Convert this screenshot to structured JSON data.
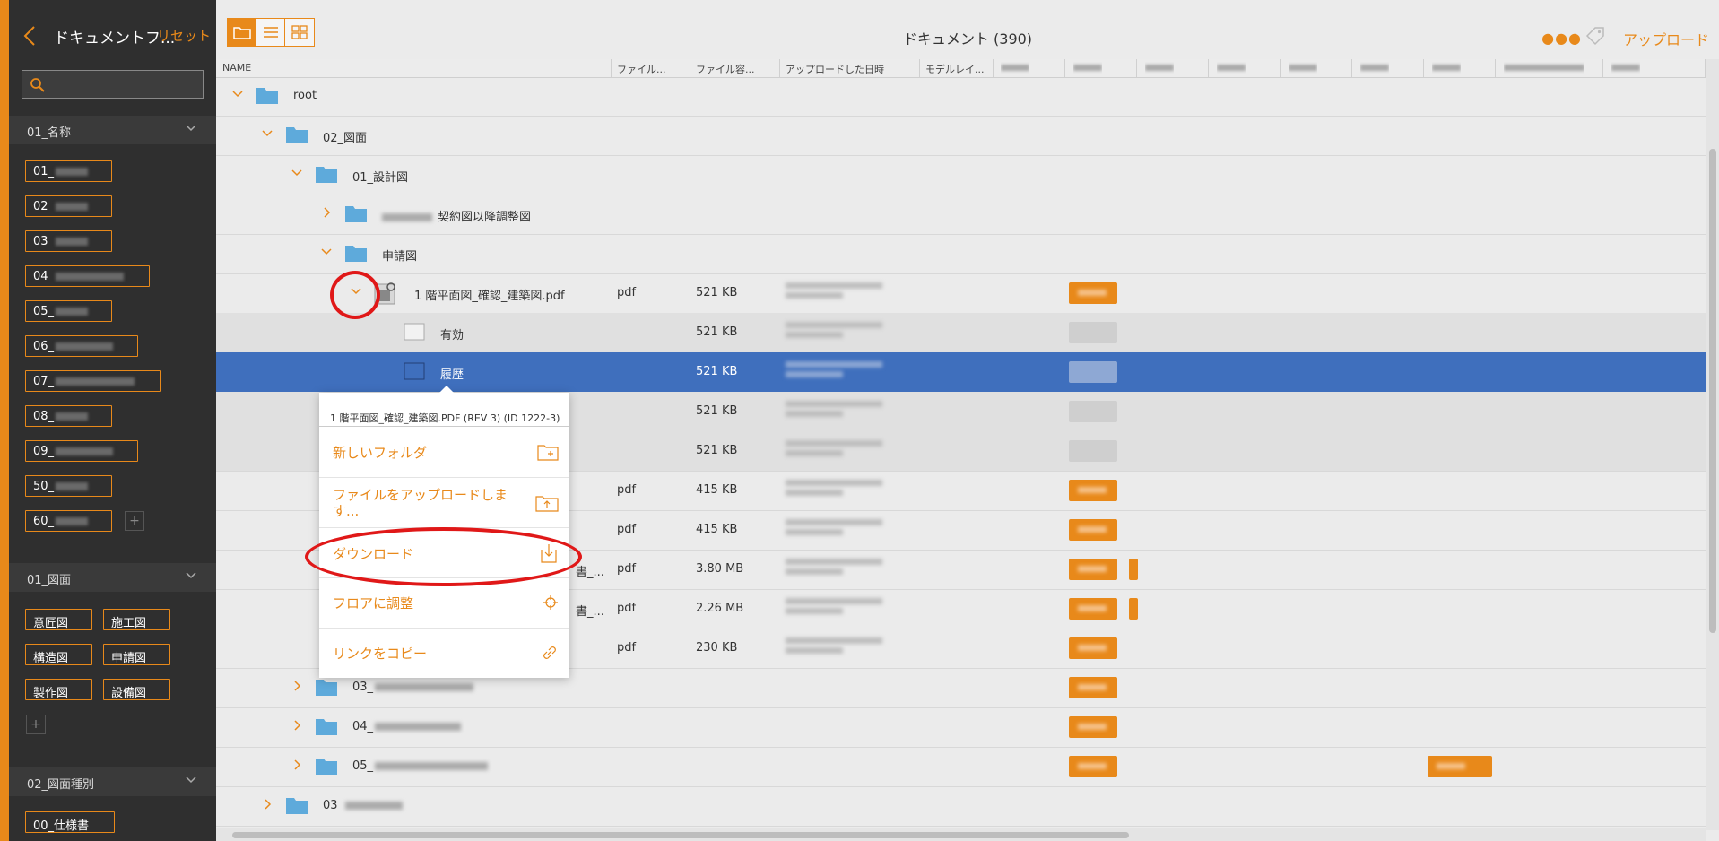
{
  "sidebar": {
    "title": "ドキュメントフ...",
    "reset": "リセット",
    "search_placeholder": "",
    "sections": [
      {
        "label": "01_名称"
      },
      {
        "label": "01_図面"
      },
      {
        "label": "02_図面種別"
      }
    ],
    "name_tags": [
      "01_",
      "02_",
      "03_",
      "04_",
      "05_",
      "06_",
      "07_",
      "08_",
      "09_",
      "50_",
      "60_"
    ],
    "drawing_tags": [
      "意匠図",
      "施工図",
      "構造図",
      "申請図",
      "製作図",
      "設備図"
    ],
    "type_tags": [
      "00_仕様書"
    ],
    "add_label": "+"
  },
  "toolbar": {
    "title": "ドキュメント (390)",
    "more": "●●●",
    "upload": "アップロード"
  },
  "columns": [
    "NAME",
    "ファイル...",
    "ファイル容...",
    "アップロードした日時",
    "モデルレイ..."
  ],
  "rows": [
    {
      "name": "root",
      "type": "",
      "size": ""
    },
    {
      "name": "02_図面",
      "type": "",
      "size": ""
    },
    {
      "name": "01_設計図",
      "type": "",
      "size": ""
    },
    {
      "name": "契約図以降調整図",
      "type": "",
      "size": ""
    },
    {
      "name": "申請図",
      "type": "",
      "size": ""
    },
    {
      "name": "1 階平面図_確認_建築図.pdf",
      "type": "pdf",
      "size": "521 KB"
    },
    {
      "name": "有効",
      "type": "",
      "size": "521 KB"
    },
    {
      "name": "履歴",
      "type": "",
      "size": "521 KB"
    },
    {
      "name": "",
      "type": "",
      "size": "521 KB"
    },
    {
      "name": "",
      "type": "",
      "size": "521 KB"
    },
    {
      "name": "",
      "type": "pdf",
      "size": "415 KB"
    },
    {
      "name": "",
      "type": "pdf",
      "size": "415 KB"
    },
    {
      "name": "書_...",
      "type": "pdf",
      "size": "3.80 MB"
    },
    {
      "name": "書_...",
      "type": "pdf",
      "size": "2.26 MB"
    },
    {
      "name": "",
      "type": "pdf",
      "size": "230 KB"
    },
    {
      "name": "03_",
      "type": "",
      "size": ""
    },
    {
      "name": "04_",
      "type": "",
      "size": ""
    },
    {
      "name": "05_",
      "type": "",
      "size": ""
    },
    {
      "name": "03_",
      "type": "",
      "size": ""
    }
  ],
  "context_menu": {
    "header": "1 階平面図_確認_建築図.PDF (REV 3) (ID 1222-3)",
    "items": [
      {
        "label": "新しいフォルダ",
        "icon": "new-folder-icon"
      },
      {
        "label": "ファイルをアップロードします...",
        "icon": "upload-folder-icon"
      },
      {
        "label": "ダウンロード",
        "icon": "download-icon"
      },
      {
        "label": "フロアに調整",
        "icon": "crosshair-icon"
      },
      {
        "label": "リンクをコピー",
        "icon": "link-icon"
      }
    ]
  },
  "colors": {
    "accent": "#e8891a",
    "selected_row": "#3f6fbd",
    "sidebar_bg": "#2f2f2f",
    "annotation": "#e01818"
  }
}
